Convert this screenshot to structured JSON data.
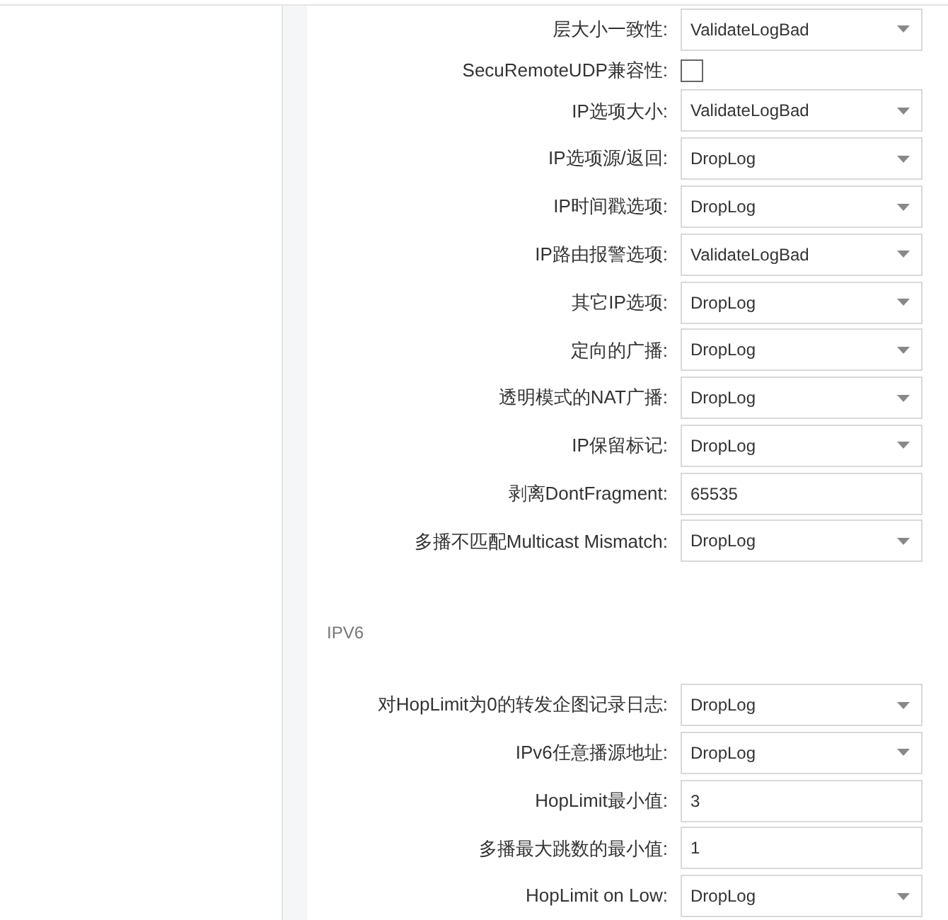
{
  "sections": [
    {
      "rows": [
        {
          "kind": "select",
          "label": "层大小一致性:",
          "value": "ValidateLogBad"
        },
        {
          "kind": "checkbox",
          "label": "SecuRemoteUDP兼容性:",
          "checked": false
        },
        {
          "kind": "select",
          "label": "IP选项大小:",
          "value": "ValidateLogBad"
        },
        {
          "kind": "select",
          "label": "IP选项源/返回:",
          "value": "DropLog"
        },
        {
          "kind": "select",
          "label": "IP时间戳选项:",
          "value": "DropLog"
        },
        {
          "kind": "select",
          "label": "IP路由报警选项:",
          "value": "ValidateLogBad"
        },
        {
          "kind": "select",
          "label": "其它IP选项:",
          "value": "DropLog"
        },
        {
          "kind": "select",
          "label": "定向的广播:",
          "value": "DropLog"
        },
        {
          "kind": "select",
          "label": "透明模式的NAT广播:",
          "value": "DropLog"
        },
        {
          "kind": "select",
          "label": "IP保留标记:",
          "value": "DropLog"
        },
        {
          "kind": "text",
          "label": "剥离DontFragment:",
          "value": "65535"
        },
        {
          "kind": "select",
          "label": "多播不匹配Multicast Mismatch:",
          "value": "DropLog"
        }
      ]
    },
    {
      "title": "IPV6",
      "rows": [
        {
          "kind": "select",
          "label": "对HopLimit为0的转发企图记录日志:",
          "value": "DropLog"
        },
        {
          "kind": "select",
          "label": "IPv6任意播源地址:",
          "value": "DropLog"
        },
        {
          "kind": "text",
          "label": "HopLimit最小值:",
          "value": "3"
        },
        {
          "kind": "text",
          "label": "多播最大跳数的最小值:",
          "value": "1"
        },
        {
          "kind": "select",
          "label": "HopLimit on Low:",
          "value": "DropLog"
        }
      ]
    }
  ]
}
